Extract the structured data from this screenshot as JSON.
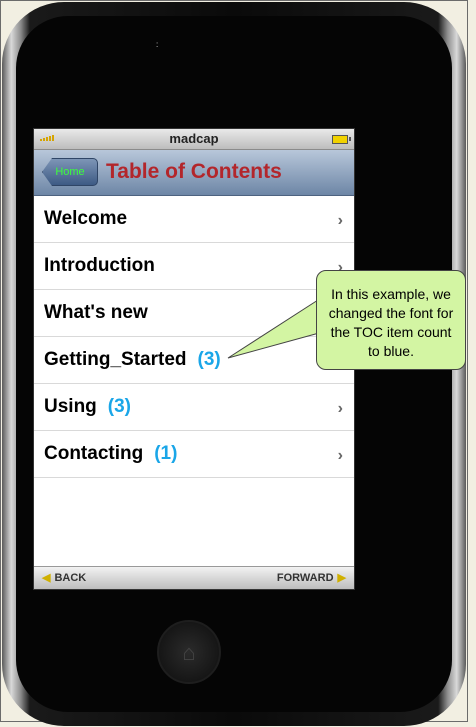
{
  "phone": {
    "carrier": "madcap",
    "nav": {
      "home_label": "Home",
      "title": "Table of Contents"
    },
    "toc_items": [
      {
        "label": "Welcome",
        "count": "",
        "chevron": true
      },
      {
        "label": "Introduction",
        "count": "",
        "chevron": true
      },
      {
        "label": "What's new",
        "count": "",
        "chevron": true
      },
      {
        "label": "Getting_Started",
        "count": "(3)",
        "chevron": false
      },
      {
        "label": "Using",
        "count": "(3)",
        "chevron": true
      },
      {
        "label": "Contacting",
        "count": "(1)",
        "chevron": true
      }
    ],
    "toolbar": {
      "back_label": "BACK",
      "forward_label": "FORWARD"
    }
  },
  "callout": {
    "text": "In this example, we changed the font for the TOC item count to blue."
  },
  "colors": {
    "count_color": "#1aa6e8",
    "title_color": "#b3262b",
    "callout_bg": "#d3f5a3"
  }
}
